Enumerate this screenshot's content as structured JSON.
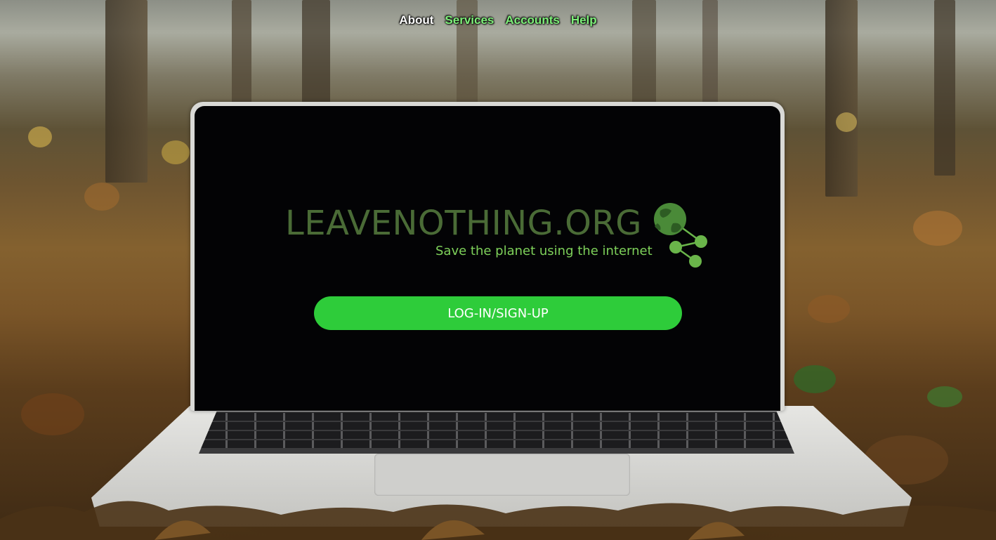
{
  "nav": {
    "items": [
      {
        "label": "About",
        "color": "#ffffff"
      },
      {
        "label": "Services",
        "color": "#7ef07a"
      },
      {
        "label": "Accounts",
        "color": "#7ef07a"
      },
      {
        "label": "Help",
        "color": "#7ef07a"
      }
    ]
  },
  "hero": {
    "logo_text": "LEAVENOTHING.ORG",
    "tagline": "Save the planet using the internet",
    "cta_label": "LOG-IN/SIGN-UP"
  },
  "colors": {
    "logo_dark_green": "#4a6b36",
    "tagline_green": "#7ed15a",
    "cta_green": "#2ecc3a",
    "screen_black": "#030305"
  },
  "icons": {
    "logo": "globe-network-icon"
  }
}
